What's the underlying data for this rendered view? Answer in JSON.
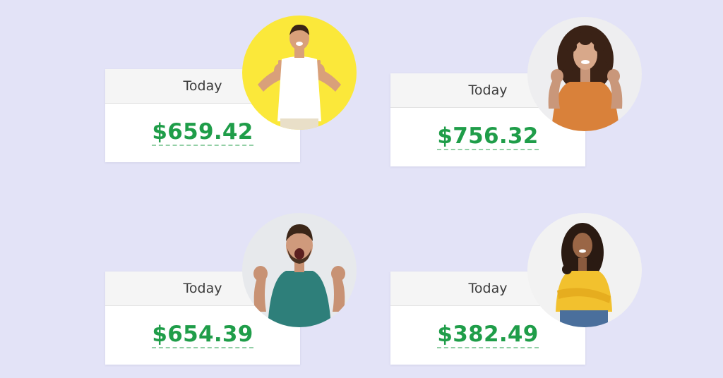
{
  "cards": [
    {
      "header": "Today",
      "amount": "$659.42"
    },
    {
      "header": "Today",
      "amount": "$756.32"
    },
    {
      "header": "Today",
      "amount": "$654.39"
    },
    {
      "header": "Today",
      "amount": "$382.49"
    }
  ],
  "colors": {
    "page_background": "#e3e3f7",
    "amount_green": "#1f9d49",
    "card_header": "#f5f5f5"
  }
}
